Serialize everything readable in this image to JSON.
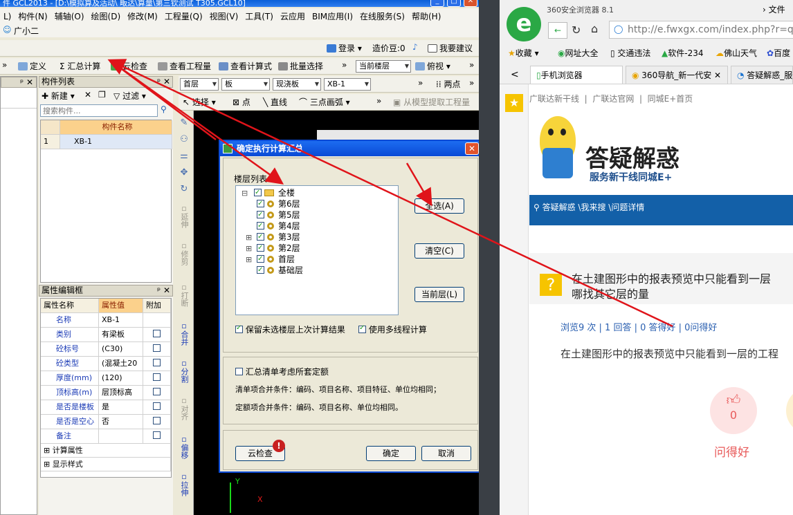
{
  "gcl": {
    "title": "件 GCL2013 - [D:\\模拟算及活动\\ 畈达\\算量\\第三钦测试 T305.GCL10]",
    "menu": [
      "L)",
      "构件(N)",
      "辅轴(O)",
      "绘图(D)",
      "修改(M)",
      "工程量(Q)",
      "视图(V)",
      "工具(T)",
      "云应用",
      "BIM应用(I)",
      "在线服务(S)",
      "帮助(H)"
    ],
    "user_tab": "广小二",
    "account": {
      "login": "登录",
      "price_beans": "造价豆:0",
      "suggest": "我要建议"
    },
    "toolbar1": {
      "define": "定义",
      "summary_calc": "汇总计算",
      "cloud_check": "云检查",
      "view_quantity": "查看工程量",
      "view_formula": "查看计算式",
      "batch_select": "批量选择",
      "floor_select": "当前楼层",
      "view_mode": "俯视"
    },
    "toolbar2": {
      "floor": "首层",
      "category": "板",
      "subtype": "现浇板",
      "component": "XB-1",
      "two_points": "两点"
    },
    "toolbar3": {
      "select": "选择",
      "point": "点",
      "line": "直线",
      "arc3": "三点画弧",
      "extract_model": "从模型提取工程量"
    },
    "component_list": {
      "title": "构件列表",
      "new_btn": "新建",
      "filter_btn": "过滤",
      "search_placeholder": "搜索构件...",
      "column_header": "构件名称",
      "rows": [
        {
          "index": "1",
          "name": "XB-1"
        }
      ]
    },
    "property_panel": {
      "title": "属性编辑框",
      "headers": [
        "属性名称",
        "属性值",
        "附加"
      ],
      "rows": [
        {
          "name": "名称",
          "value": "XB-1"
        },
        {
          "name": "类别",
          "value": "有梁板"
        },
        {
          "name": "砼标号",
          "value": "(C30)"
        },
        {
          "name": "砼类型",
          "value": "(混凝土20"
        },
        {
          "name": "厚度(mm)",
          "value": "(120)"
        },
        {
          "name": "顶标高(m)",
          "value": "层顶标高"
        },
        {
          "name": "是否是楼板",
          "value": "是"
        },
        {
          "name": "是否是空心",
          "value": "否"
        },
        {
          "name": "备注",
          "value": ""
        }
      ],
      "groups": [
        "计算属性",
        "显示样式"
      ]
    },
    "vtools": [
      "延伸",
      "修剪",
      "打断",
      "合并",
      "分割",
      "对齐",
      "偏移",
      "拉伸"
    ]
  },
  "dialog": {
    "title": "确定执行计算汇总",
    "floor_list_label": "楼层列表：",
    "tree": [
      {
        "label": "全楼",
        "level": 0,
        "expander": "⊟"
      },
      {
        "label": "第6层",
        "level": 1,
        "expander": ""
      },
      {
        "label": "第5层",
        "level": 1,
        "expander": ""
      },
      {
        "label": "第4层",
        "level": 1,
        "expander": ""
      },
      {
        "label": "第3层",
        "level": 1,
        "expander": "⊞"
      },
      {
        "label": "第2层",
        "level": 1,
        "expander": "⊞"
      },
      {
        "label": "首层",
        "level": 1,
        "expander": "⊞"
      },
      {
        "label": "基础层",
        "level": 1,
        "expander": ""
      }
    ],
    "select_all": "全选(A)",
    "clear": "清空(C)",
    "current_floor": "当前层(L)",
    "keep_results": "保留未选楼层上次计算结果",
    "multithread": "使用多线程计算",
    "consider_quota": "汇总清单考虑所套定额",
    "bill_merge": "清单项合并条件：编码、项目名称、项目特征、单位均相同；",
    "quota_merge": "定额项合并条件：编码、项目名称、单位均相同。",
    "cloud_check": "云检查",
    "ok": "确定",
    "cancel": "取消"
  },
  "browser": {
    "name": "360安全浏览器 8.1",
    "file_menu": "文件",
    "url": "http://e.fwxgx.com/index.php?r=qu",
    "bookmarks": [
      "收藏",
      "网址大全",
      "交通违法",
      "软件-234",
      "佛山天气",
      "百度"
    ],
    "tabs": [
      "手机浏览器",
      "360导航_新一代安",
      "答疑解惑_服"
    ],
    "crumbs": [
      "广联达新干线",
      "广联达官网",
      "同城E+首页"
    ],
    "banner_title": "答疑解惑",
    "banner_sub": "服务新干线同城E+",
    "breadcrumb_nav": "答疑解惑 \\我来搜 \\问题详情",
    "question_title": "在土建图形中的报表预览中只能看到一层",
    "question_title2": "哪找其它层的量",
    "stats": "浏览9 次 | 1 回答 | 0 答得好 | 0问得好",
    "question_body": "在土建图形中的报表预览中只能看到一层的工程",
    "like_count": "0",
    "like_label": "问得好"
  }
}
